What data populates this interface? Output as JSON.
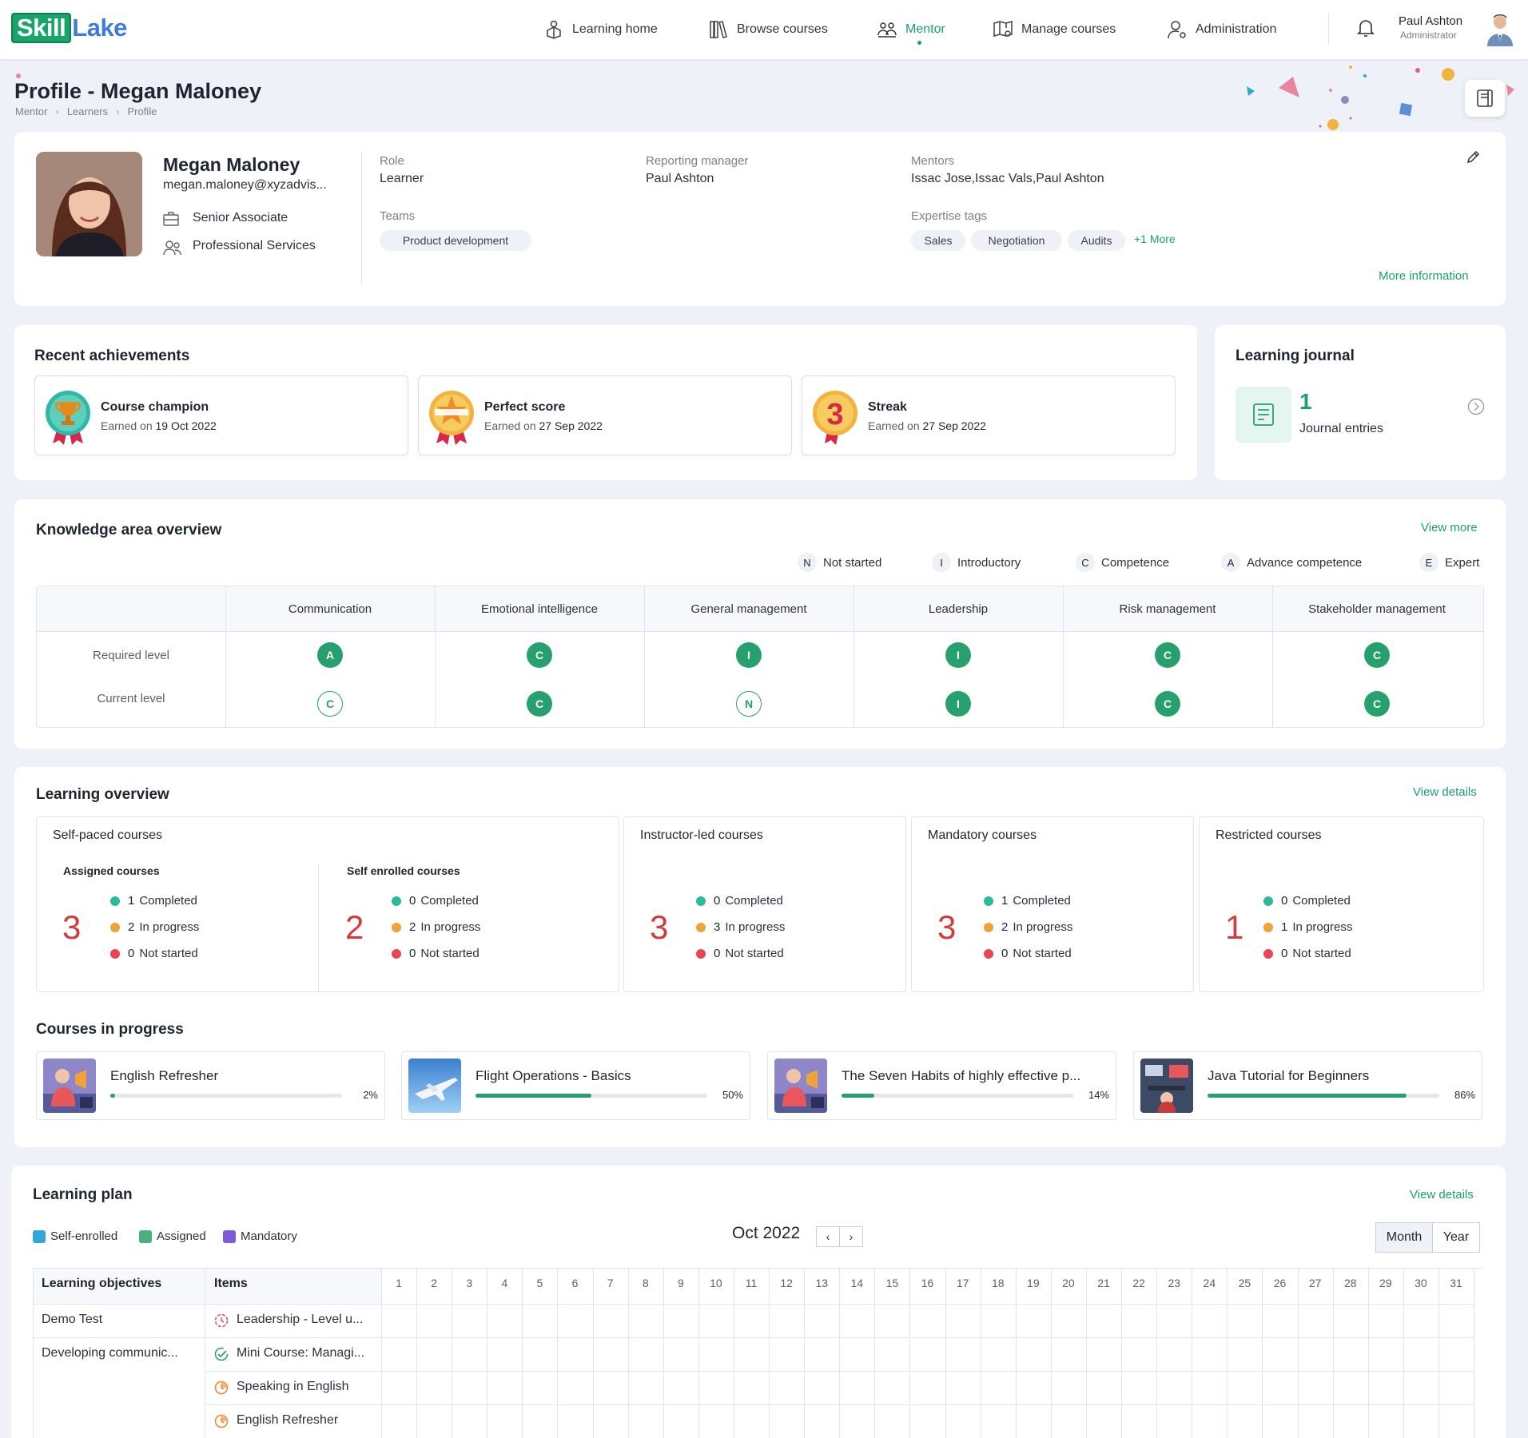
{
  "brand": {
    "skill": "Skill",
    "lake": "Lake"
  },
  "nav": {
    "items": [
      {
        "label": "Learning home",
        "icon": "learning-home-icon"
      },
      {
        "label": "Browse courses",
        "icon": "books-icon"
      },
      {
        "label": "Mentor",
        "icon": "mentor-icon",
        "active": true
      },
      {
        "label": "Manage courses",
        "icon": "manage-courses-icon"
      },
      {
        "label": "Administration",
        "icon": "admin-user-icon"
      }
    ]
  },
  "user": {
    "name": "Paul Ashton",
    "role": "Administrator"
  },
  "page": {
    "title": "Profile - Megan Maloney",
    "breadcrumb": [
      "Mentor",
      "Learners",
      "Profile"
    ]
  },
  "profile": {
    "name": "Megan Maloney",
    "email": "megan.maloney@xyzadvis...",
    "designation": "Senior Associate",
    "department": "Professional Services",
    "role_label": "Role",
    "role": "Learner",
    "manager_label": "Reporting manager",
    "manager": "Paul Ashton",
    "mentors_label": "Mentors",
    "mentors": "Issac Jose,Issac Vals,Paul Ashton",
    "teams_label": "Teams",
    "teams": [
      "Product development"
    ],
    "tags_label": "Expertise tags",
    "tags": [
      "Sales",
      "Negotiation",
      "Audits"
    ],
    "tags_more": "+1 More",
    "more_info": "More information"
  },
  "achievements": {
    "title": "Recent achievements",
    "earned_prefix": "Earned on",
    "items": [
      {
        "title": "Course champion",
        "date": "19 Oct 2022"
      },
      {
        "title": "Perfect score",
        "date": "27 Sep 2022"
      },
      {
        "title": "Streak",
        "date": "27 Sep 2022",
        "badge": "3"
      }
    ]
  },
  "journal": {
    "title": "Learning journal",
    "count": "1",
    "label": "Journal entries"
  },
  "knowledge": {
    "title": "Knowledge area overview",
    "view_more": "View more",
    "legend": [
      {
        "code": "N",
        "label": "Not started"
      },
      {
        "code": "I",
        "label": "Introductory"
      },
      {
        "code": "C",
        "label": "Competence"
      },
      {
        "code": "A",
        "label": "Advance competence"
      },
      {
        "code": "E",
        "label": "Expert"
      }
    ],
    "row_labels": [
      "Required level",
      "Current level"
    ],
    "areas": [
      {
        "name": "Communication",
        "required": "A",
        "current": "C",
        "current_met": false
      },
      {
        "name": "Emotional intelligence",
        "required": "C",
        "current": "C",
        "current_met": true
      },
      {
        "name": "General management",
        "required": "I",
        "current": "N",
        "current_met": false
      },
      {
        "name": "Leadership",
        "required": "I",
        "current": "I",
        "current_met": true
      },
      {
        "name": "Risk management",
        "required": "C",
        "current": "C",
        "current_met": true
      },
      {
        "name": "Stakeholder management",
        "required": "C",
        "current": "C",
        "current_met": true
      }
    ]
  },
  "overview": {
    "title": "Learning overview",
    "view_details": "View details",
    "status_labels": {
      "completed": "Completed",
      "in_progress": "In progress",
      "not_started": "Not started"
    },
    "self_paced": {
      "title": "Self-paced courses",
      "assigned": {
        "label": "Assigned courses",
        "total": "3",
        "completed": "1",
        "in_progress": "2",
        "not_started": "0"
      },
      "self_enrolled": {
        "label": "Self enrolled courses",
        "total": "2",
        "completed": "0",
        "in_progress": "2",
        "not_started": "0"
      }
    },
    "instructor_led": {
      "title": "Instructor-led courses",
      "total": "3",
      "completed": "0",
      "in_progress": "3",
      "not_started": "0"
    },
    "mandatory": {
      "title": "Mandatory courses",
      "total": "3",
      "completed": "1",
      "in_progress": "2",
      "not_started": "0"
    },
    "restricted": {
      "title": "Restricted courses",
      "total": "1",
      "completed": "0",
      "in_progress": "1",
      "not_started": "0"
    }
  },
  "courses_in_progress": {
    "title": "Courses in progress",
    "items": [
      {
        "title": "English Refresher",
        "percent_label": "2%",
        "progress": 0.02
      },
      {
        "title": "Flight Operations - Basics",
        "percent_label": "50%",
        "progress": 0.5
      },
      {
        "title": "The Seven Habits of highly effective p...",
        "percent_label": "14%",
        "progress": 0.14
      },
      {
        "title": "Java Tutorial for Beginners",
        "percent_label": "86%",
        "progress": 0.86
      }
    ]
  },
  "learning_plan": {
    "title": "Learning plan",
    "view_details": "View details",
    "legend": [
      {
        "label": "Self-enrolled",
        "color": "#2fa7d8"
      },
      {
        "label": "Assigned",
        "color": "#4bb07b"
      },
      {
        "label": "Mandatory",
        "color": "#7c5ad8"
      }
    ],
    "month": "Oct 2022",
    "prev": "‹",
    "next": "›",
    "views": [
      "Month",
      "Year"
    ],
    "selected_view": "Month",
    "col_objectives": "Learning objectives",
    "col_items": "Items",
    "days": [
      "1",
      "2",
      "3",
      "4",
      "5",
      "6",
      "7",
      "8",
      "9",
      "10",
      "11",
      "12",
      "13",
      "14",
      "15",
      "16",
      "17",
      "18",
      "19",
      "20",
      "21",
      "22",
      "23",
      "24",
      "25",
      "26",
      "27",
      "28",
      "29",
      "30",
      "31"
    ],
    "rows": [
      {
        "objective": "Demo Test",
        "item": "Leadership - Level u...",
        "status": "pending"
      },
      {
        "objective": "Developing communic...",
        "item": "Mini Course: Managi...",
        "status": "done"
      },
      {
        "objective": "",
        "item": "Speaking in English",
        "status": "progress"
      },
      {
        "objective": "",
        "item": "English Refresher",
        "status": "progress"
      }
    ]
  }
}
